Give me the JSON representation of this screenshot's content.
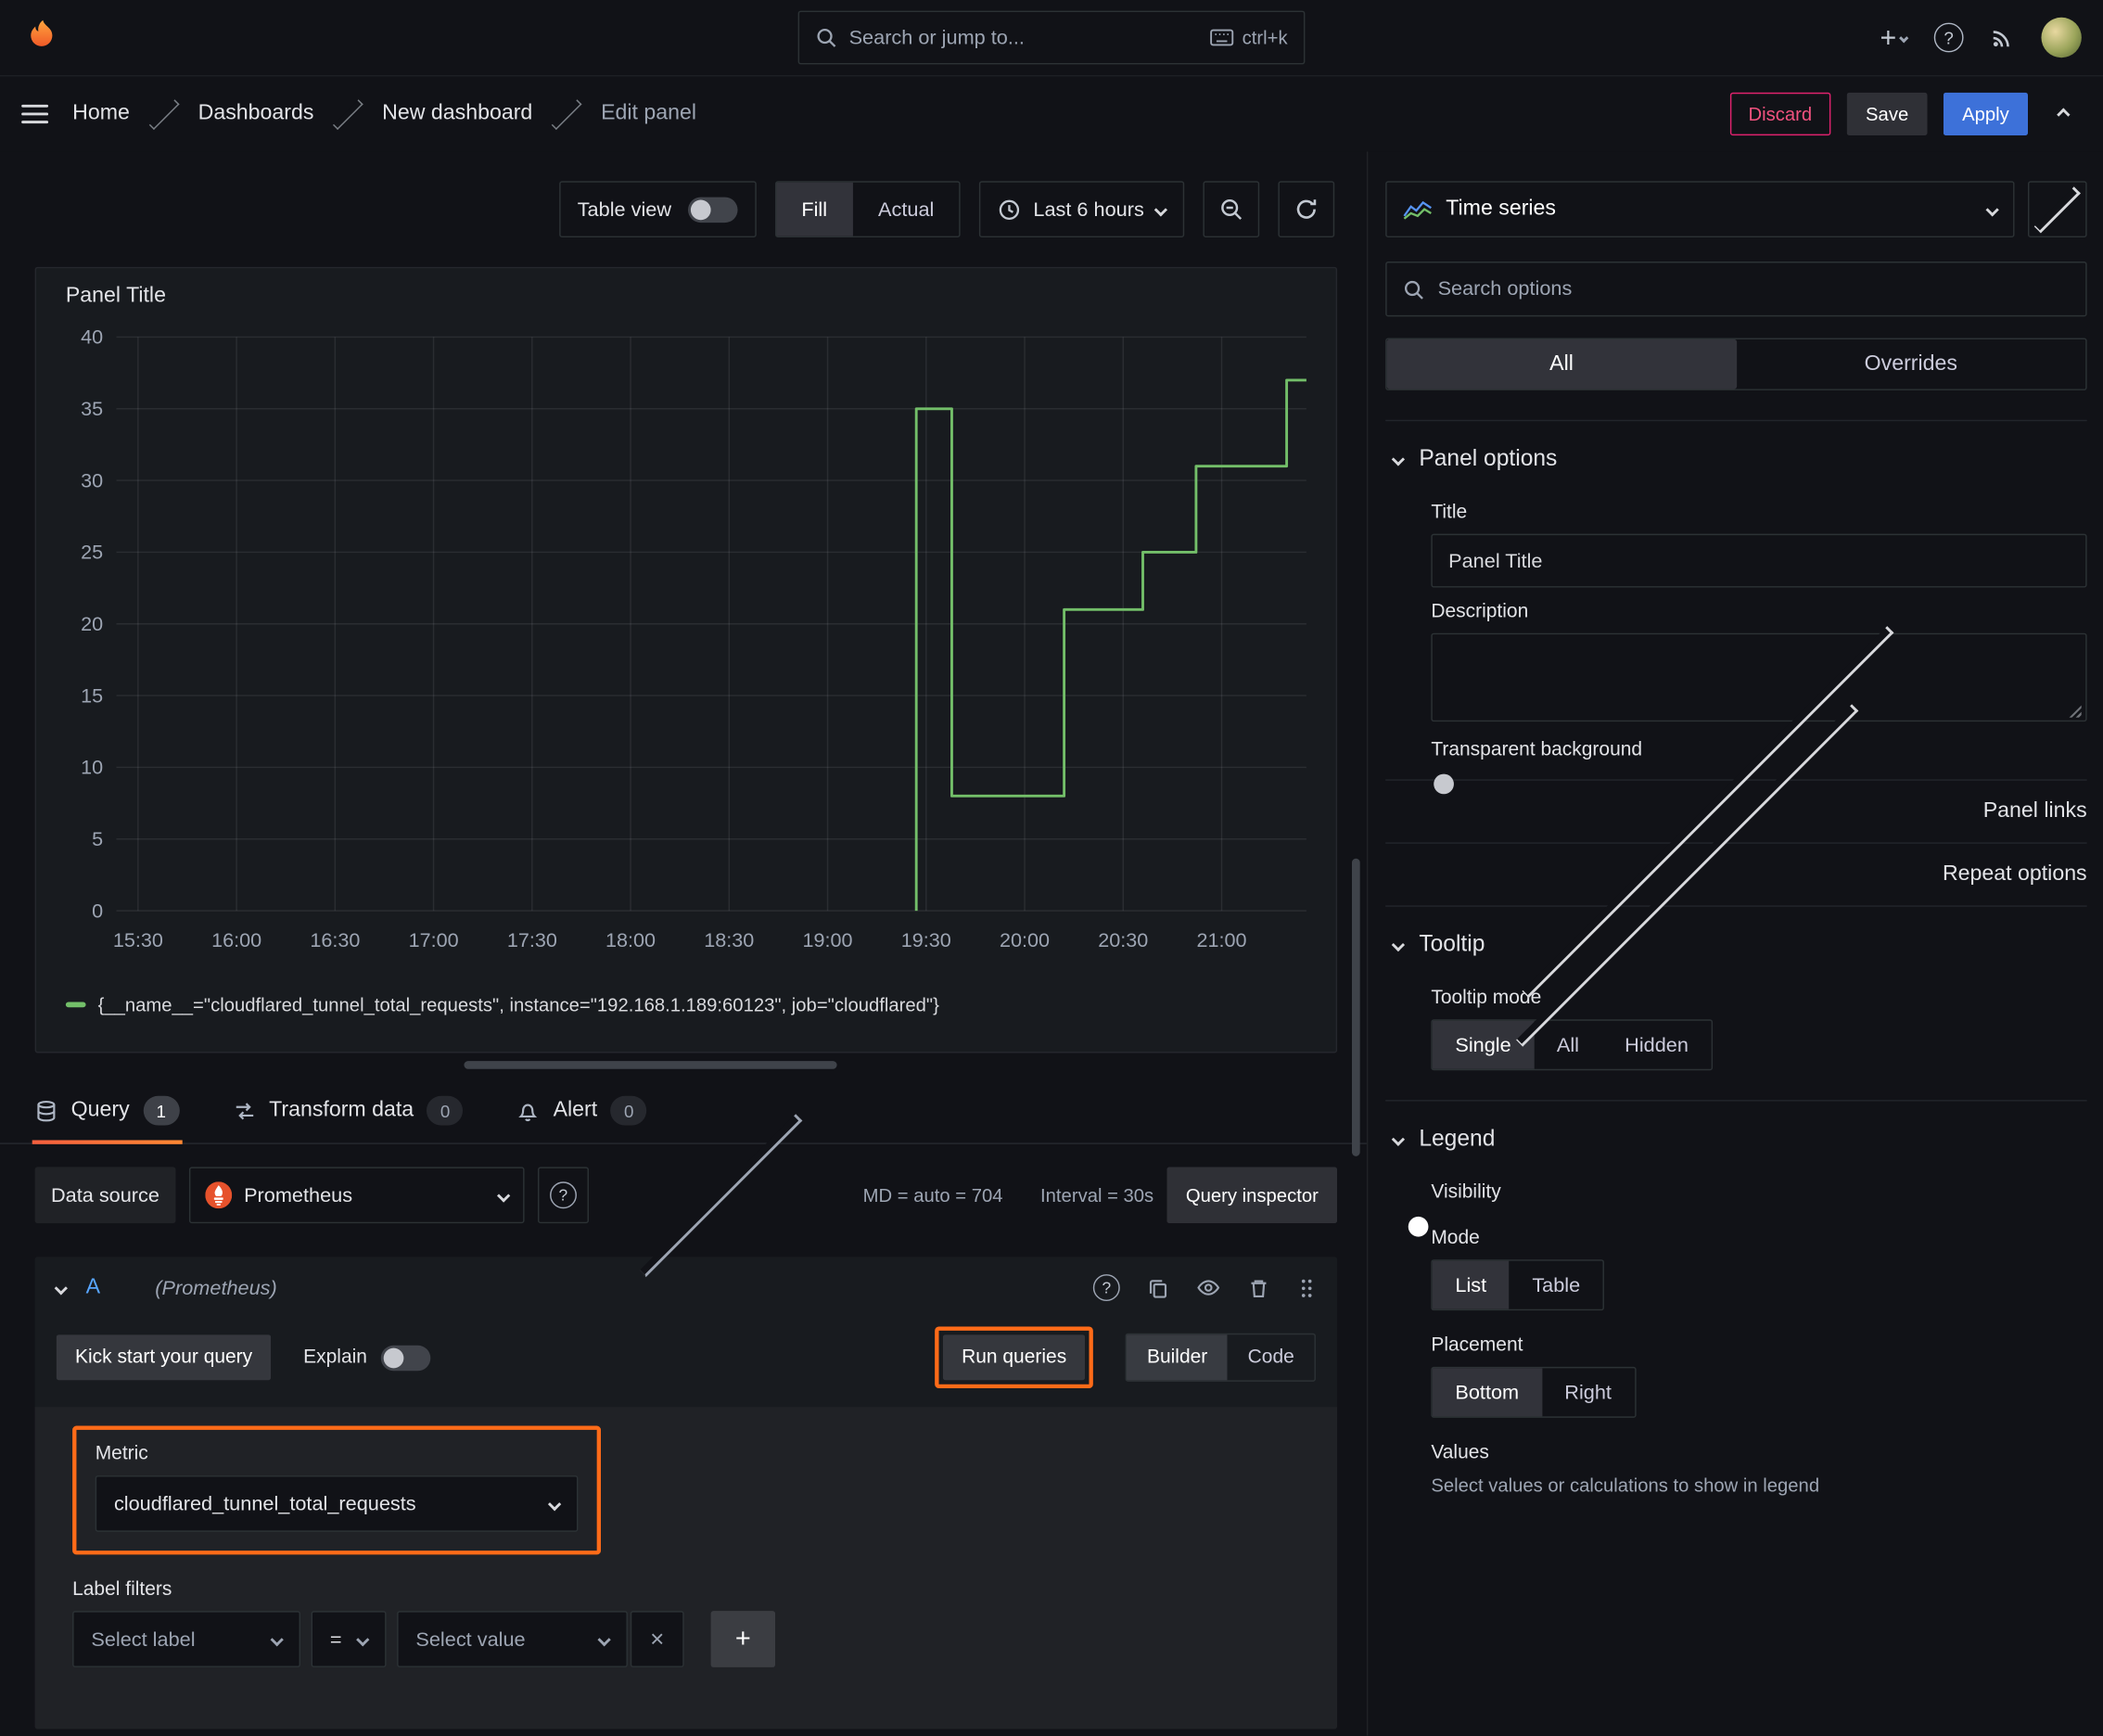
{
  "icons": {
    "help": "?",
    "plus": "+",
    "close": "×"
  },
  "topnav": {
    "search_placeholder": "Search or jump to...",
    "shortcut": "ctrl+k"
  },
  "breadcrumb": {
    "items": [
      "Home",
      "Dashboards",
      "New dashboard",
      "Edit panel"
    ]
  },
  "actions": {
    "discard": "Discard",
    "save": "Save",
    "apply": "Apply"
  },
  "toolbar": {
    "table_view": "Table view",
    "fill": "Fill",
    "actual": "Actual",
    "time_range": "Last 6 hours"
  },
  "panel": {
    "title": "Panel Title",
    "legend_label": "{__name__=\"cloudflared_tunnel_total_requests\", instance=\"192.168.1.189:60123\", job=\"cloudflared\"}"
  },
  "chart_data": {
    "type": "line",
    "style": "step",
    "title": "Panel Title",
    "x_type": "time",
    "x_range": [
      15.39,
      21.43
    ],
    "y_range": [
      0,
      40
    ],
    "y_ticks": [
      0,
      5,
      10,
      15,
      20,
      25,
      30,
      35,
      40
    ],
    "x_ticks": [
      {
        "t": 15.5,
        "label": "15:30"
      },
      {
        "t": 16.0,
        "label": "16:00"
      },
      {
        "t": 16.5,
        "label": "16:30"
      },
      {
        "t": 17.0,
        "label": "17:00"
      },
      {
        "t": 17.5,
        "label": "17:30"
      },
      {
        "t": 18.0,
        "label": "18:00"
      },
      {
        "t": 18.5,
        "label": "18:30"
      },
      {
        "t": 19.0,
        "label": "19:00"
      },
      {
        "t": 19.5,
        "label": "19:30"
      },
      {
        "t": 20.0,
        "label": "20:00"
      },
      {
        "t": 20.5,
        "label": "20:30"
      },
      {
        "t": 21.0,
        "label": "21:00"
      }
    ],
    "series": [
      {
        "name": "{__name__=\"cloudflared_tunnel_total_requests\", instance=\"192.168.1.189:60123\", job=\"cloudflared\"}",
        "color": "#73bf69",
        "points": [
          [
            19.45,
            0
          ],
          [
            19.45,
            35
          ],
          [
            19.63,
            35
          ],
          [
            19.63,
            8
          ],
          [
            20.2,
            8
          ],
          [
            20.2,
            21
          ],
          [
            20.6,
            21
          ],
          [
            20.6,
            25
          ],
          [
            20.87,
            25
          ],
          [
            20.87,
            31
          ],
          [
            21.33,
            31
          ],
          [
            21.33,
            37
          ],
          [
            21.43,
            37
          ]
        ]
      }
    ],
    "grid": true,
    "legend_position": "bottom"
  },
  "tabs": {
    "query": {
      "label": "Query",
      "count": "1"
    },
    "transform": {
      "label": "Transform data",
      "count": "0"
    },
    "alert": {
      "label": "Alert",
      "count": "0"
    }
  },
  "query": {
    "datasource_label": "Data source",
    "datasource_name": "Prometheus",
    "max_data_points": "MD = auto = 704",
    "interval": "Interval = 30s",
    "inspector": "Query inspector",
    "ref_id": "A",
    "ref_ds": "(Prometheus)",
    "kickstart": "Kick start your query",
    "explain": "Explain",
    "run_queries": "Run queries",
    "builder": "Builder",
    "code": "Code",
    "metric_label": "Metric",
    "metric_value": "cloudflared_tunnel_total_requests",
    "label_filters_label": "Label filters",
    "select_label": "Select label",
    "operator": "=",
    "select_value": "Select value"
  },
  "options": {
    "viz_type": "Time series",
    "search_placeholder": "Search options",
    "tab_all": "All",
    "tab_overrides": "Overrides",
    "panel_options_title": "Panel options",
    "title_label": "Title",
    "title_value": "Panel Title",
    "description_label": "Description",
    "transparent_label": "Transparent background",
    "panel_links": "Panel links",
    "repeat_options": "Repeat options",
    "tooltip_title": "Tooltip",
    "tooltip_mode_label": "Tooltip mode",
    "tooltip_single": "Single",
    "tooltip_all": "All",
    "tooltip_hidden": "Hidden",
    "legend_title": "Legend",
    "visibility_label": "Visibility",
    "mode_label": "Mode",
    "mode_list": "List",
    "mode_table": "Table",
    "placement_label": "Placement",
    "placement_bottom": "Bottom",
    "placement_right": "Right",
    "values_label": "Values",
    "values_hint": "Select values or calculations to show in legend"
  }
}
